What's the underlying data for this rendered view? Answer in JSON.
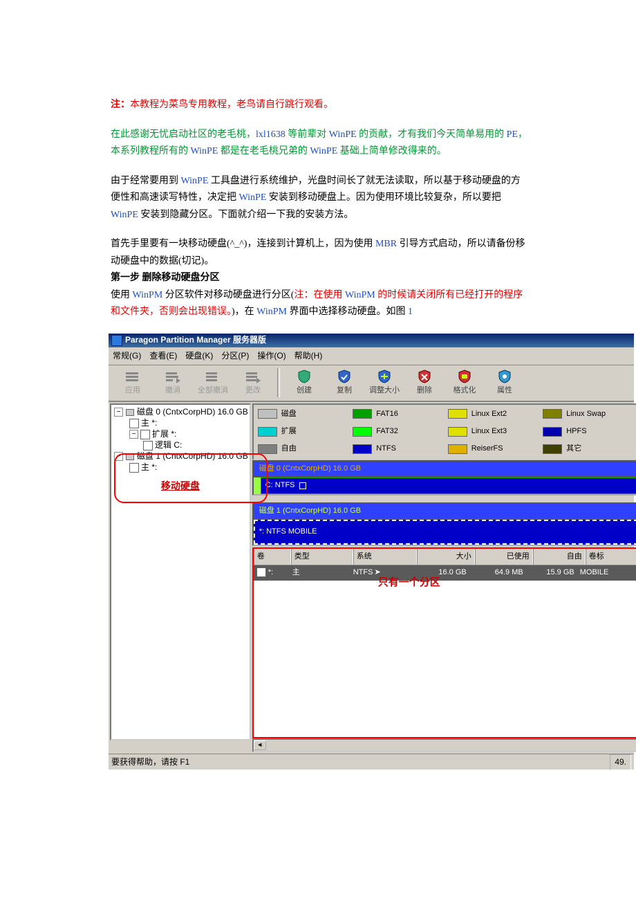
{
  "doc": {
    "note_label": "注：",
    "note_body": "本教程为菜鸟专用教程，老鸟请自行跳行观看。",
    "thanks_a": "在此感谢无忧启动社区的老毛桃，",
    "thanks_b": "lxl1638",
    "thanks_c": " 等前辈对 ",
    "thanks_d": "WinPE",
    "thanks_e": " 的贡献，才有我们今天简单易用的 ",
    "thanks_f": "PE",
    "thanks_g": "，本系列教程所有的 ",
    "thanks_h": "WinPE",
    "thanks_i": " 都是在老毛桃兄弟的 ",
    "thanks_j": "WinPE",
    "thanks_k": " 基础上简单修改得来的。",
    "p2a": "由于经常要用到 ",
    "p2b": "WinPE",
    "p2c": " 工具盘进行系统维护，光盘时间长了就无法读取，所以基于移动硬盘的方便性和高速读写特性，决定把 ",
    "p2d": "WinPE",
    "p2e": " 安装到移动硬盘上。因为使用环境比较复杂，所以要把 ",
    "p2f": "WinPE",
    "p2g": " 安装到隐藏分区。下面就介绍一下我的安装方法。",
    "p3a": "首先手里要有一块移动硬盘(^_^)，连接到计算机上，因为使用 ",
    "p3b": "MBR",
    "p3c": " 引导方式启动，所以请备份移动硬盘中的数据(切记)。",
    "step1": "第一步 删除移动硬盘分区",
    "p4a": "使用 ",
    "p4b": "WinPM",
    "p4c": " 分区软件对移动硬盘进行分区(",
    "p4d": "注：在使用 ",
    "p4e": "WinPM",
    "p4f": " 的时候请关闭所有已经打开的程序和文件夹，否则会出现错误。",
    "p4g": ")，在 ",
    "p4h": "WinPM",
    "p4i": " 界面中选择移动硬盘。如图 ",
    "p4j": "1"
  },
  "app": {
    "title": "Paragon Partition Manager 服务器版",
    "menus": [
      "常规(G)",
      "查看(E)",
      "硬盘(K)",
      "分区(P)",
      "操作(O)",
      "帮助(H)"
    ],
    "toolbar": [
      "应用",
      "撤消",
      "全部撤消",
      "更改",
      "创建",
      "复制",
      "调整大小",
      "删除",
      "格式化",
      "属性"
    ],
    "legend": [
      {
        "c": "#c0c0c0",
        "t": "磁盘"
      },
      {
        "c": "#00a000",
        "t": "FAT16"
      },
      {
        "c": "#e0e000",
        "t": "Linux Ext2"
      },
      {
        "c": "#808000",
        "t": "Linux Swap"
      },
      {
        "c": "#00d0d0",
        "t": "扩展"
      },
      {
        "c": "#00ff00",
        "t": "FAT32"
      },
      {
        "c": "#e0e000",
        "t": "Linux Ext3"
      },
      {
        "c": "#0000b0",
        "t": "HPFS"
      },
      {
        "c": "#808080",
        "t": "自由"
      },
      {
        "c": "#0000c8",
        "t": "NTFS"
      },
      {
        "c": "#e0b000",
        "t": "ReiserFS"
      },
      {
        "c": "#404000",
        "t": "其它"
      }
    ],
    "tree": {
      "d0": "磁盘 0 (CntxCorpHD) 16.0 GB",
      "d0p": "主 *:",
      "d0e": "扩展 *:",
      "d0l": "逻辑 C:",
      "d1": "磁盘 1 (CntxCorpHD) 16.0 GB",
      "d1p": "主 *:",
      "annot": "移动硬盘"
    },
    "disk0": {
      "hdr": "磁盘 0 (CntxCorpHD) 16.0 GB",
      "vol": "C: NTFS"
    },
    "disk1": {
      "hdr": "磁盘 1 (CntxCorpHD) 16.0 GB",
      "vol": "*: NTFS MOBILE"
    },
    "thead": [
      "卷",
      "类型",
      "系统",
      "大小",
      "已使用",
      "自由",
      "卷标"
    ],
    "row": {
      "vol": "*:",
      "type": "主",
      "sys": "NTFS",
      "size": "16.0 GB",
      "used": "64.9 MB",
      "free": "15.9 GB",
      "label": "MOBILE"
    },
    "annot2": "只有一个分区",
    "status_left": "要获得帮助，请按 F1",
    "status_right": "49."
  }
}
